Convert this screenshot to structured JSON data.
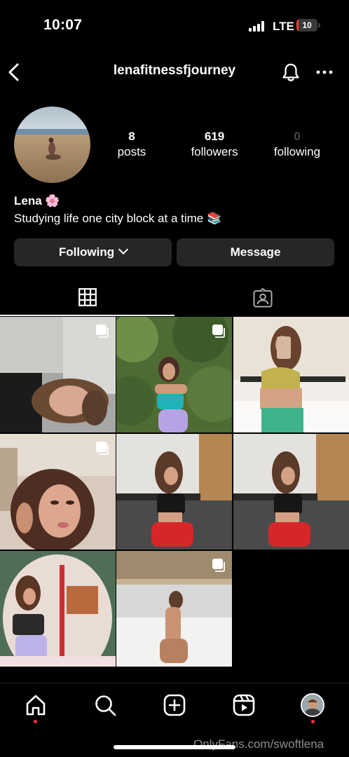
{
  "status_bar": {
    "time": "10:07",
    "network": "LTE",
    "battery": "10",
    "battery_level": 0.1,
    "battery_color": "#ff3b30"
  },
  "header": {
    "username": "lenafitnessfjourney",
    "icons": [
      "back-icon",
      "bell-icon",
      "more-icon"
    ]
  },
  "profile": {
    "stats": [
      {
        "value": "8",
        "label": "posts"
      },
      {
        "value": "619",
        "label": "followers"
      },
      {
        "value": "0",
        "label": "following"
      }
    ],
    "name": "Lena 🌸",
    "bio": "Studying life one city block at a time 📚"
  },
  "actions": {
    "following_label": "Following",
    "message_label": "Message"
  },
  "tabs": [
    {
      "icon": "grid-icon",
      "active": true
    },
    {
      "icon": "tagged-icon",
      "active": false
    }
  ],
  "posts": [
    {
      "multi": true
    },
    {
      "multi": true
    },
    {
      "multi": false
    },
    {
      "multi": true
    },
    {
      "multi": false
    },
    {
      "multi": false
    },
    {
      "multi": false
    },
    {
      "multi": true
    }
  ],
  "bottom_nav": [
    "home-icon",
    "search-icon",
    "create-icon",
    "reels-icon",
    "profile-avatar"
  ],
  "watermark": "OnlyFans.com/swoftlena",
  "colors": {
    "background": "#000000",
    "button": "#262626",
    "notification_dot": "#ff3040"
  }
}
